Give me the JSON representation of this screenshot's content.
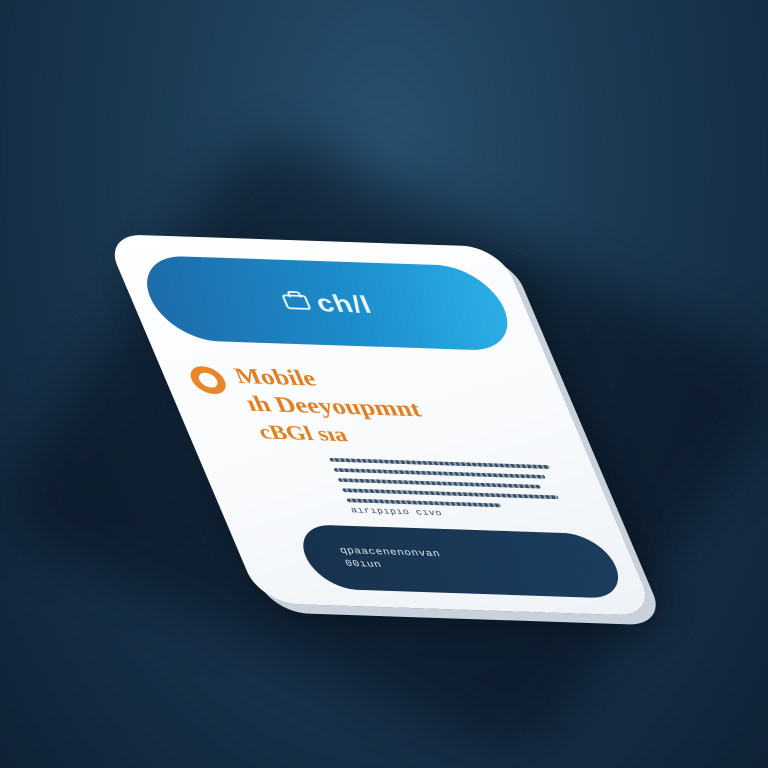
{
  "header": {
    "title": "ch/l"
  },
  "content": {
    "title_line_1": "Mobile",
    "title_line_2": "ıh Deeyoupmnt",
    "title_line_3": "cBGl sıa",
    "caption": "aırıpıpıo cıvo"
  },
  "footer": {
    "line_1": "qpaacenenonvan",
    "line_2": "00ıun"
  },
  "colors": {
    "background": "#1c3b55",
    "card": "#ffffff",
    "header_accent": "#1d8ccb",
    "title_accent": "#e17f23",
    "footer_accent": "#1b3d5e"
  },
  "icons": {
    "header": "briefcase-icon",
    "title": "ring-icon"
  }
}
